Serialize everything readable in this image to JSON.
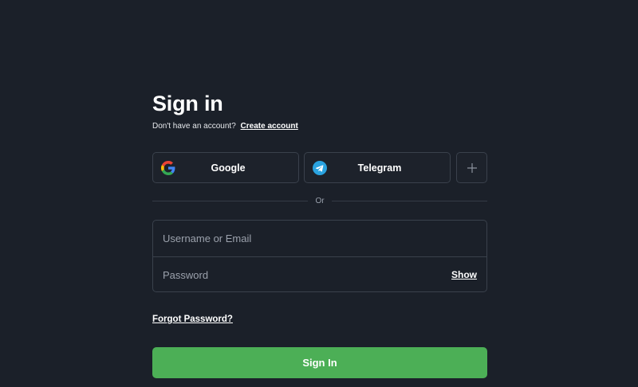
{
  "auth": {
    "title": "Sign in",
    "no_account_text": "Don't have an account?",
    "create_account_link": "Create account"
  },
  "social": {
    "google_label": "Google",
    "telegram_label": "Telegram",
    "more_icon": "plus-icon"
  },
  "divider": {
    "or_label": "Or"
  },
  "form": {
    "username_placeholder": "Username or Email",
    "username_value": "",
    "password_placeholder": "Password",
    "password_value": "",
    "show_label": "Show",
    "forgot_label": "Forgot Password?",
    "submit_label": "Sign In"
  },
  "colors": {
    "background": "#1b2029",
    "border": "#3a414c",
    "accent_green": "#4caf56",
    "telegram_blue": "#2aa3e0"
  }
}
